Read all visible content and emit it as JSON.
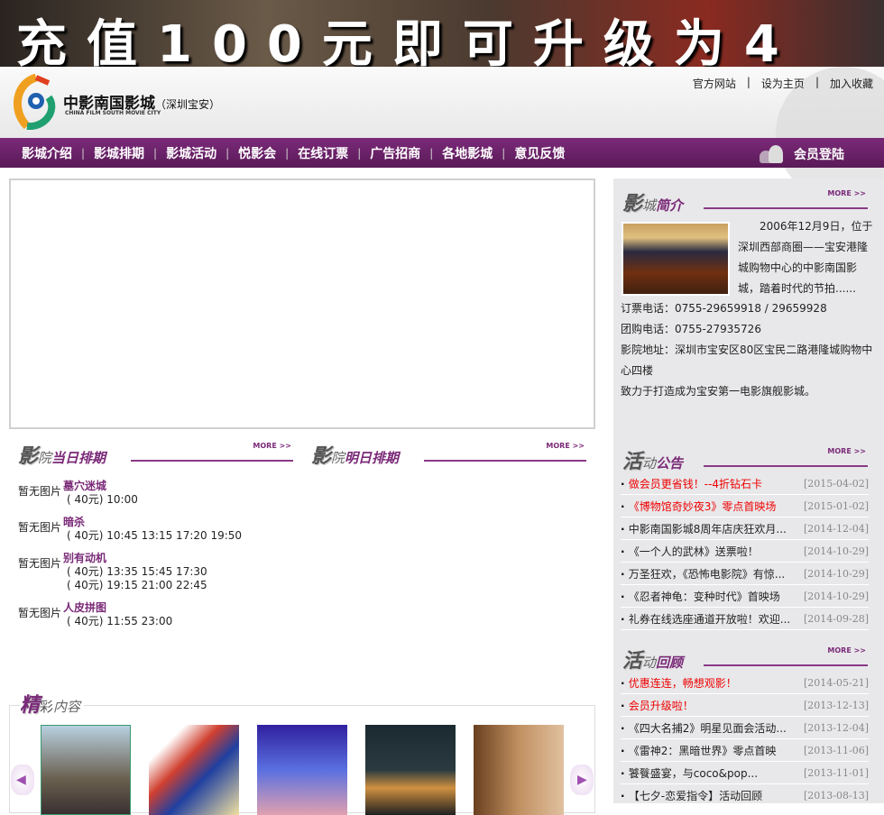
{
  "banner": {
    "text": "充值100元即可升级为4"
  },
  "header": {
    "brand": "中影南国影城",
    "branch": "（深圳宝安）",
    "brand_en": "CHINA FILM SOUTH MOVIE CITY",
    "links": [
      "官方网站",
      "设为主页",
      "加入收藏"
    ]
  },
  "nav": {
    "items": [
      "影城介绍",
      "影城排期",
      "影城活动",
      "悦影会",
      "在线订票",
      "广告招商",
      "各地影城",
      "意见反馈"
    ],
    "login": "会员登陆"
  },
  "today": {
    "t1": "影",
    "t2": "院",
    "t3": "当日排期",
    "more": "MORE >>",
    "movies": [
      {
        "img": "暂无图片",
        "name": "墓穴迷城",
        "times": [
          "( 40元) 10:00"
        ]
      },
      {
        "img": "暂无图片",
        "name": "暗杀",
        "times": [
          "( 40元) 10:45 13:15 17:20 19:50"
        ]
      },
      {
        "img": "暂无图片",
        "name": "别有动机",
        "times": [
          "( 40元) 13:35 15:45 17:30",
          "( 40元) 19:15 21:00 22:45"
        ]
      },
      {
        "img": "暂无图片",
        "name": "人皮拼图",
        "times": [
          "( 40元) 11:55 23:00"
        ]
      }
    ]
  },
  "tomorrow": {
    "t1": "影",
    "t2": "院",
    "t3": "明日排期",
    "more": "MORE >>"
  },
  "featured": {
    "t1": "精",
    "t2": "彩",
    "t3": "内容"
  },
  "intro": {
    "t1": "影",
    "t2": "城",
    "t3": "简介",
    "more": "MORE >>",
    "text": "2006年12月9日，位于深圳西部商圈——宝安港隆城购物中心的中影南国影城，踏着时代的节拍......",
    "lines": [
      "订票电话：0755-29659918 / 29659928",
      "团购电话：0755-27935726",
      "影院地址：深圳市宝安区80区宝民二路港隆城购物中心四楼",
      "致力于打造成为宝安第一电影旗舰影城。"
    ]
  },
  "notices": {
    "t1": "活",
    "t2": "动",
    "t3": "公告",
    "more": "MORE >>",
    "items": [
      {
        "title": "做会员更省钱！--4折钻石卡",
        "date": "[2015-04-02]",
        "red": true
      },
      {
        "title": "《博物馆奇妙夜3》零点首映场",
        "date": "[2015-01-02]",
        "red": true
      },
      {
        "title": "中影南国影城8周年店庆狂欢月...",
        "date": "[2014-12-04]"
      },
      {
        "title": "《一个人的武林》送票啦！",
        "date": "[2014-10-29]"
      },
      {
        "title": "万圣狂欢，《恐怖电影院》有惊...",
        "date": "[2014-10-29]"
      },
      {
        "title": "《忍者神龟：变种时代》首映场",
        "date": "[2014-10-29]"
      },
      {
        "title": "礼券在线选座通道开放啦！欢迎...",
        "date": "[2014-09-28]"
      }
    ]
  },
  "review": {
    "t1": "活",
    "t2": "动",
    "t3": "回顾",
    "more": "MORE >>",
    "items": [
      {
        "title": "优惠连连，畅想观影！",
        "date": "[2014-05-21]",
        "red": true
      },
      {
        "title": "会员升级啦！",
        "date": "[2013-12-13]",
        "red": true
      },
      {
        "title": "《四大名捕2》明星见面会活动...",
        "date": "[2013-12-04]"
      },
      {
        "title": "《雷神2：黑暗世界》零点首映",
        "date": "[2013-11-06]"
      },
      {
        "title": "饕餮盛宴，与coco&pop...",
        "date": "[2013-11-01]"
      },
      {
        "title": "【七夕-恋爱指令】活动回顾",
        "date": "[2013-08-13]"
      }
    ]
  }
}
